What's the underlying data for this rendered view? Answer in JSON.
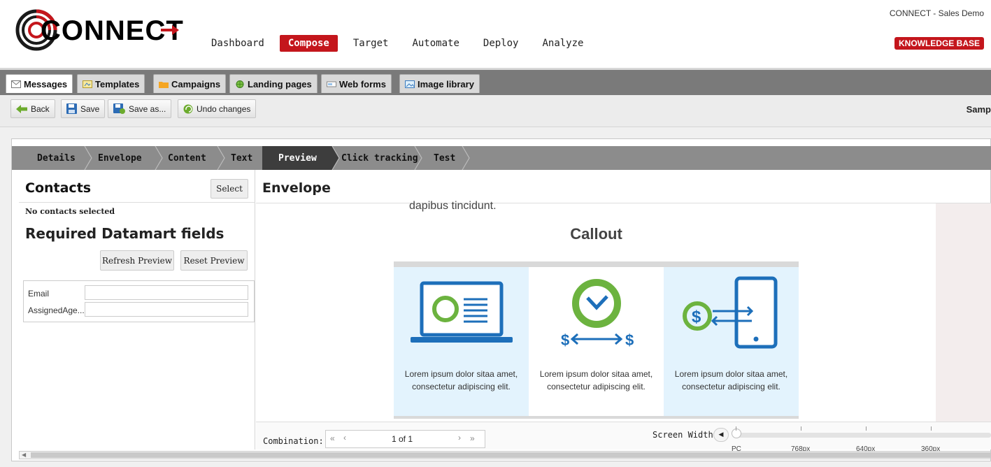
{
  "header": {
    "logo_text": "CONNECT",
    "nav": [
      "Dashboard",
      "Compose",
      "Target",
      "Automate",
      "Deploy",
      "Analyze"
    ],
    "active_nav": "Compose",
    "demo_label": "CONNECT - Sales Demo",
    "kb_label": "KNOWLEDGE BASE"
  },
  "tabs": [
    "Messages",
    "Templates",
    "Campaigns",
    "Landing pages",
    "Web forms",
    "Image library"
  ],
  "toolbar": {
    "back": "Back",
    "save": "Save",
    "save_as": "Save as...",
    "undo": "Undo changes",
    "right_label": "Samp"
  },
  "steps": [
    "Details",
    "Envelope",
    "Content",
    "Text",
    "Preview",
    "Click tracking",
    "Test"
  ],
  "left": {
    "contacts_title": "Contacts",
    "select_btn": "Select",
    "no_contacts": "No contacts selected",
    "req_title": "Required Datamart fields",
    "refresh_btn": "Refresh Preview",
    "reset_btn": "Reset Preview",
    "field_email": "Email",
    "field_agent": "AssignedAge..."
  },
  "preview": {
    "title": "Envelope",
    "top_text": "dapibus tincidunt.",
    "callout": "Callout",
    "cells": [
      "Lorem ipsum dolor sitaa amet, consectetur adipiscing elit.",
      "Lorem ipsum dolor sitaa amet, consectetur adipiscing elit.",
      "Lorem ipsum dolor sitaa amet, consectetur adipiscing elit."
    ]
  },
  "bottom": {
    "combination_label": "Combination:",
    "pager_text": "1 of 1",
    "screen_width_label": "Screen Width:",
    "ticks": [
      "PC",
      "768px",
      "640px",
      "360px"
    ]
  },
  "colors": {
    "brand_red": "#c4161c",
    "icon_blue": "#1d6fba",
    "icon_green": "#6cb33f"
  }
}
